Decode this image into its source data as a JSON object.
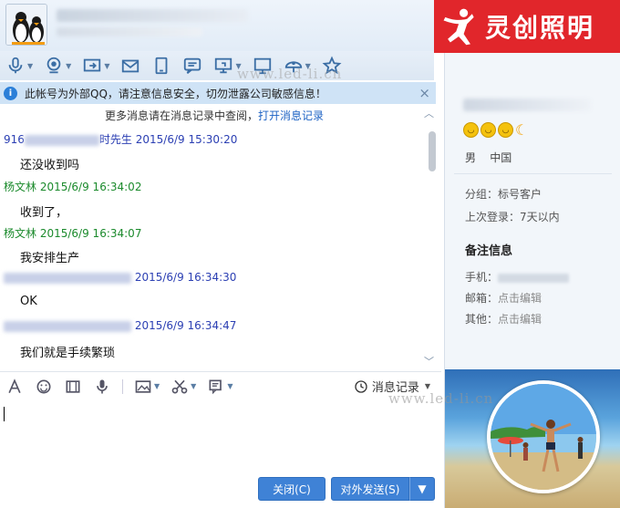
{
  "brand": {
    "name": "灵创照明",
    "mark_text": "灵创"
  },
  "watermark": "www.led-li.cn",
  "notice": {
    "text": "此帐号为外部QQ，请注意信息安全，切勿泄露公司敏感信息！",
    "close": "×"
  },
  "chat": {
    "history_tip": "更多消息请在消息记录中查阅，",
    "history_link": "打开消息记录",
    "messages": [
      {
        "sender_visible": "916",
        "sender_suffix": "时先生",
        "time": "2015/6/9 15:30:20",
        "text": "还没收到吗",
        "color": "#2b3fb3"
      },
      {
        "sender_visible": "杨文林",
        "sender_suffix": "",
        "time": "2015/6/9 16:34:02",
        "text": "收到了，",
        "color": "#1b8a2c"
      },
      {
        "sender_visible": "杨文林",
        "sender_suffix": "",
        "time": "2015/6/9 16:34:07",
        "text": "我安排生产",
        "color": "#1b8a2c"
      },
      {
        "sender_visible": "",
        "sender_suffix": "",
        "time": "2015/6/9 16:34:30",
        "text": "OK",
        "color": "#2b3fb3"
      },
      {
        "sender_visible": "",
        "sender_suffix": "",
        "time": "2015/6/9 16:34:47",
        "text": "我们就是手续繁琐",
        "color": "#2b3fb3"
      }
    ]
  },
  "toolbar": {
    "icons": [
      "microphone-icon",
      "camera-icon",
      "share-screen-icon",
      "mail-icon",
      "tablet-icon",
      "message-board-icon",
      "remote-desktop-icon",
      "monitor-icon",
      "app-center-icon",
      "favorite-icon"
    ]
  },
  "input_toolbar": {
    "history_label": "消息记录"
  },
  "buttons": {
    "close": "关闭(C)",
    "send": "对外发送(S)"
  },
  "profile": {
    "gender": "男",
    "region": "中国",
    "group_label": "分组：标号客户",
    "last_login": "上次登录：7天以内",
    "remarks_title": "备注信息",
    "phone_label": "手机：",
    "email_label": "邮箱：",
    "email_value": "点击编辑",
    "other_label": "其他：",
    "other_value": "点击编辑"
  },
  "colors": {
    "brand_red": "#e1262b",
    "link_blue": "#1e63c4",
    "button_blue": "#3f82d6",
    "notice_bg": "#cfe3f6"
  }
}
